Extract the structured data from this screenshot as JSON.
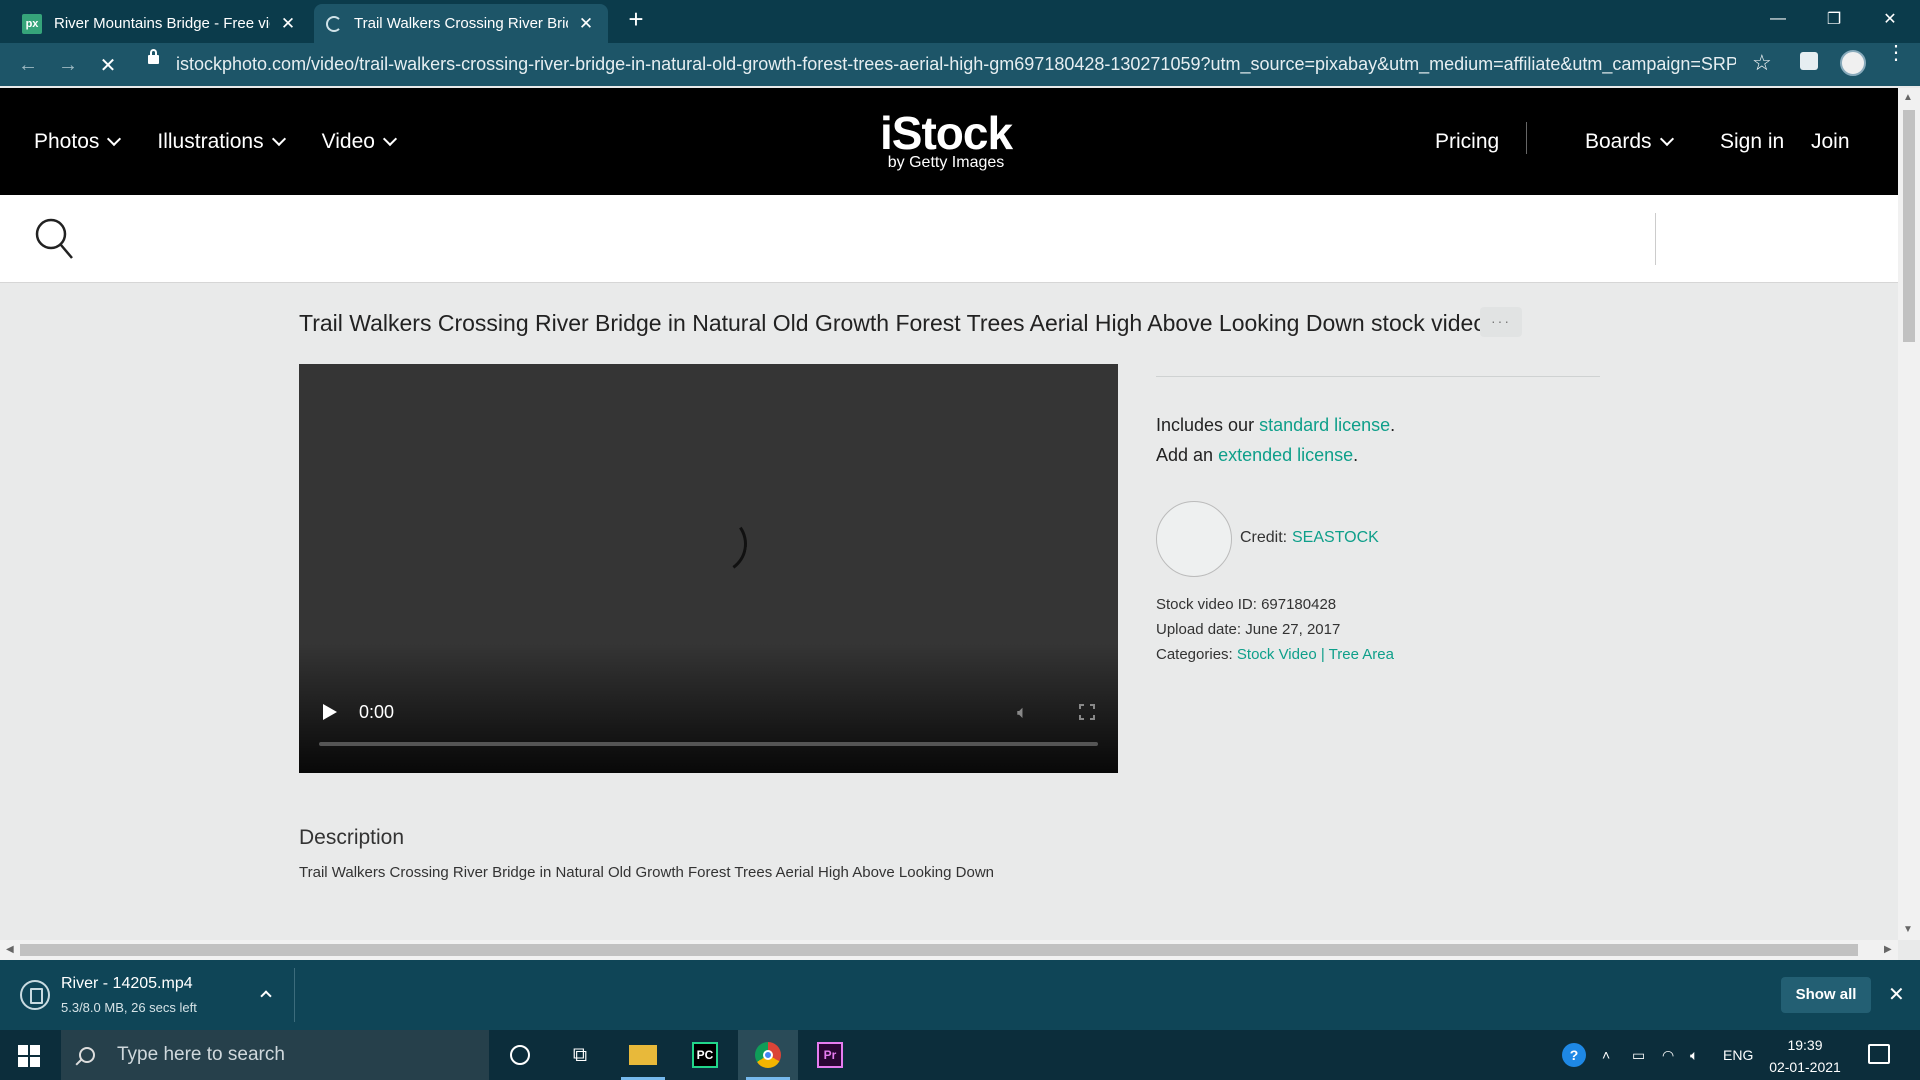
{
  "browser": {
    "tabs": [
      {
        "title": "River Mountains Bridge - Free video",
        "favicon": "px",
        "active": false
      },
      {
        "title": "Trail Walkers Crossing River Bridge",
        "favicon": "loading",
        "active": true
      }
    ],
    "new_tab": "+",
    "url": "istockphoto.com/video/trail-walkers-crossing-river-bridge-in-natural-old-growth-forest-trees-aerial-high-gm697180428-130271059?utm_source=pixabay&utm_medium=affiliate&utm_campaign=SRP...",
    "accent": "#0b3b4b"
  },
  "site": {
    "nav": {
      "photos": "Photos",
      "illustrations": "Illustrations",
      "video": "Video",
      "pricing": "Pricing",
      "boards": "Boards",
      "sign_in": "Sign in",
      "join": "Join"
    },
    "logo": {
      "main": "iStock",
      "sub": "by Getty Images"
    },
    "search": {
      "placeholder": ""
    }
  },
  "page": {
    "title": "Trail Walkers Crossing River Bridge in Natural Old Growth Forest Trees Aerial High Above Looking Down stock video",
    "more": "···",
    "player": {
      "time": "0:00",
      "progress": 0
    },
    "license": {
      "line1_prefix": "Includes our ",
      "line1_link": "standard license",
      "line1_suffix": ".",
      "line2_prefix": "Add an ",
      "line2_link": "extended license",
      "line2_suffix": "."
    },
    "credit": {
      "label": "Credit:",
      "name": "SEASTOCK"
    },
    "meta": {
      "id_label": "Stock video ID:",
      "id_value": "697180428",
      "upload_label": "Upload date:",
      "upload_value": "June 27, 2017",
      "categories_label": "Categories:",
      "category_1": "Stock Video",
      "separator": "|",
      "category_2": "Tree Area"
    },
    "description": {
      "heading": "Description",
      "text": "Trail Walkers Crossing River Bridge in Natural Old Growth Forest Trees Aerial High Above Looking Down"
    },
    "link_color": "#0e9f8a"
  },
  "download": {
    "filename": "River - 14205.mp4",
    "status": "5.3/8.0 MB, 26 secs left",
    "show_all": "Show all"
  },
  "taskbar": {
    "search_placeholder": "Type here to search",
    "lang": "ENG",
    "time": "19:39",
    "date": "02-01-2021",
    "apps": [
      "cortana-icon",
      "task-view-icon",
      "file-explorer-icon",
      "pycharm-icon",
      "chrome-icon",
      "premiere-icon"
    ]
  }
}
